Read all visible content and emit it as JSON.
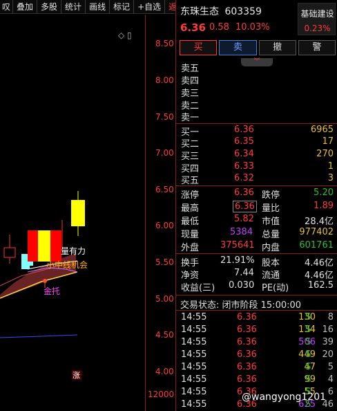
{
  "toolbar": {
    "items": [
      "叹",
      "叠加",
      "多股",
      "统计",
      "画线",
      "标记",
      "+自选",
      "返回"
    ]
  },
  "chart": {
    "price_ticks": [
      "8.50",
      "8.00",
      "7.50",
      "7.00",
      "6.50",
      "6.00",
      "5.50",
      "5.00",
      "4.50",
      "4.00"
    ],
    "volume_tick": "12000",
    "annotations": {
      "liang_you_li": "量有力",
      "short_line": "小中线机会",
      "jin_tuo": "金托",
      "zhang_mark": "涨"
    },
    "top_icons": "◇ ▯",
    "colors": {
      "up": "#ff0000",
      "yellow": "#ffff00",
      "cyan": "#7fffff",
      "axis": "#ff3a3a",
      "band": "#7a2a2a"
    }
  },
  "stock": {
    "name": "东珠生态",
    "code": "603359",
    "price": "6.36",
    "change": "0.58",
    "change_pct": "10.03%",
    "badge_title": "基础建设",
    "badge_value": "0.23%"
  },
  "trade_buttons": {
    "buy": "买",
    "sell": "卖",
    "cancel": "撤",
    "alert": "警"
  },
  "collapse_icon": "chevrons-down-icon",
  "order_book": {
    "asks": [
      {
        "label": "卖五",
        "price": "",
        "vol": ""
      },
      {
        "label": "卖四",
        "price": "",
        "vol": ""
      },
      {
        "label": "卖三",
        "price": "",
        "vol": ""
      },
      {
        "label": "卖二",
        "price": "",
        "vol": ""
      },
      {
        "label": "卖一",
        "price": "",
        "vol": ""
      }
    ],
    "bids": [
      {
        "label": "买一",
        "price": "6.36",
        "vol": "6965"
      },
      {
        "label": "买二",
        "price": "6.35",
        "vol": "17"
      },
      {
        "label": "买三",
        "price": "6.34",
        "vol": "270"
      },
      {
        "label": "买四",
        "price": "6.33",
        "vol": "1"
      },
      {
        "label": "买五",
        "price": "6.32",
        "vol": "3"
      }
    ]
  },
  "stats": {
    "limit_up_label": "涨停",
    "limit_up": "6.36",
    "limit_down_label": "跌停",
    "limit_down": "5.20",
    "high_label": "最高",
    "high": "6.36",
    "vol_ratio_label": "量比",
    "vol_ratio": "1.89",
    "low_label": "最低",
    "low": "5.82",
    "mkt_cap_label": "市值",
    "mkt_cap": "28.4亿",
    "cur_vol_label": "现量",
    "cur_vol": "5384",
    "total_vol_label": "总量",
    "total_vol": "977402",
    "outer_label": "外盘",
    "outer": "375641",
    "inner_label": "内盘",
    "inner": "601761",
    "turnover_label": "换手",
    "turnover": "21.91%",
    "share_cap_label": "股本",
    "share_cap": "4.46亿",
    "nav_label": "净资",
    "nav": "7.44",
    "float_label": "流通",
    "float": "4.46亿",
    "eps_label": "收益(三)",
    "eps": "0.030",
    "pe_label": "PE(动)",
    "pe": "162.5"
  },
  "trading_status": "交易状态: 闭市阶段 15:00:00",
  "ticks": [
    {
      "time": "14:55",
      "price": "6.36",
      "vol": "130",
      "side": "S",
      "num": "8",
      "vol_color": "#e6c230"
    },
    {
      "time": "14:55",
      "price": "6.36",
      "vol": "134",
      "side": "S",
      "num": "16",
      "vol_color": "#e6c230"
    },
    {
      "time": "14:55",
      "price": "6.36",
      "vol": "506",
      "side": "S",
      "num": "39",
      "vol_color": "#c040ff"
    },
    {
      "time": "14:55",
      "price": "6.36",
      "vol": "449",
      "side": "S",
      "num": "20",
      "vol_color": "#e6c230"
    },
    {
      "time": "14:55",
      "price": "6.36",
      "vol": "47",
      "side": "S",
      "num": "5",
      "vol_color": "#e6c230"
    },
    {
      "time": "14:55",
      "price": "6.36",
      "vol": "99",
      "side": "S",
      "num": "4",
      "vol_color": "#e6c230"
    },
    {
      "time": "14:55",
      "price": "6.36",
      "vol": "55",
      "side": "S",
      "num": "6",
      "vol_color": "#e6c230"
    },
    {
      "time": "14:55",
      "price": "6.36",
      "vol": "625",
      "side": "S",
      "num": "46",
      "vol_color": "#c040ff"
    }
  ],
  "watermark": "@wangyong1201"
}
